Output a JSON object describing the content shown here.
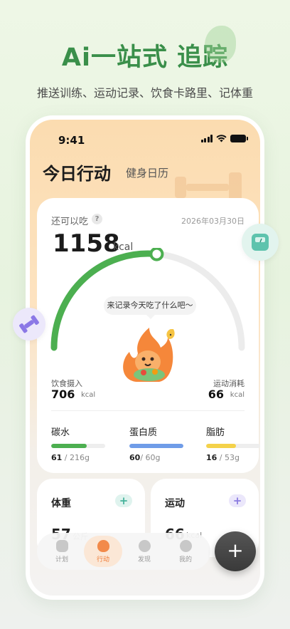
{
  "banner": {
    "headline": "Ai一站式 追踪",
    "subline": "推送训练、运动记录、饮食卡路里、记体重"
  },
  "status_bar": {
    "time": "9:41"
  },
  "header": {
    "title": "今日行动",
    "calendar_tab": "健身日历"
  },
  "summary": {
    "remain_label": "还可以吃",
    "help": "?",
    "date": "2026年03月30日",
    "remain_value": "1158",
    "unit": "kcal",
    "speech": "来记录今天吃了什么吧～",
    "gauge_progress": 0.53
  },
  "intake": {
    "label": "饮食摄入",
    "value": "706",
    "unit": "kcal"
  },
  "burn": {
    "label": "运动消耗",
    "value": "66",
    "unit": "kcal"
  },
  "macros": [
    {
      "label": "碳水",
      "current": "61",
      "total": " / 216g",
      "ratio": 0.66,
      "color": "#4caf50"
    },
    {
      "label": "蛋白质",
      "current": "60",
      "total": "/ 60g",
      "ratio": 1.0,
      "color": "#6f9ce8"
    },
    {
      "label": "脂肪",
      "current": "16",
      "total": " / 53g",
      "ratio": 0.55,
      "color": "#f4d24a"
    }
  ],
  "cards": {
    "weight": {
      "title": "体重",
      "add": "+",
      "value": "57",
      "unit": "公斤"
    },
    "exercise": {
      "title": "运动",
      "add": "+",
      "value": "66",
      "unit": "kcal"
    }
  },
  "tabbar": {
    "items": [
      {
        "label": "计划",
        "icon": "calendar-icon"
      },
      {
        "label": "行动",
        "icon": "flame-icon"
      },
      {
        "label": "发现",
        "icon": "discover-icon"
      },
      {
        "label": "我的",
        "icon": "profile-icon"
      }
    ],
    "fab": "+"
  },
  "colors": {
    "brand_green": "#3a8f4a",
    "gauge_green": "#4caf50",
    "active_tab": "#ef7a35"
  }
}
